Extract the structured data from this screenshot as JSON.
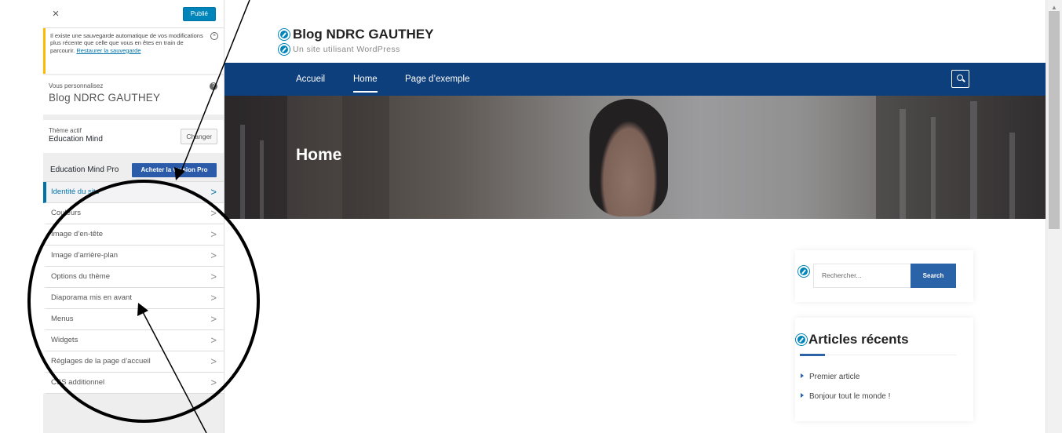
{
  "sidebar": {
    "close_glyph": "×",
    "publish_label": "Publié",
    "notice": {
      "text": "Il existe une sauvegarde automatique de vos modifications plus récente que celle que vous en êtes en train de parcourir. ",
      "link": "Restaurer la sauvegarde"
    },
    "customizing_label": "Vous personnalisez",
    "customizing_title": "Blog NDRC GAUTHEY",
    "help_glyph": "?",
    "theme_label": "Thème actif",
    "theme_name": "Education Mind",
    "change_label": "Changer",
    "pro_label": "Education Mind Pro",
    "pro_button": "Acheter la version Pro",
    "menu": [
      {
        "label": "Identité du site",
        "active": true
      },
      {
        "label": "Couleurs"
      },
      {
        "label": "Image d’en-tête"
      },
      {
        "label": "Image d’arrière-plan"
      },
      {
        "label": "Options du thème"
      },
      {
        "label": "Diaporama mis en avant"
      },
      {
        "label": "Menus"
      },
      {
        "label": "Widgets"
      },
      {
        "label": "Réglages de la page d’accueil"
      },
      {
        "label": "CSS additionnel"
      }
    ],
    "chevron_glyph": ">"
  },
  "site": {
    "title": "Blog NDRC GAUTHEY",
    "tagline": "Un site utilisant WordPress",
    "nav": [
      "Accueil",
      "Home",
      "Page d’exemple"
    ],
    "nav_current": "Home",
    "hero_title": "Home"
  },
  "widgets": {
    "search_placeholder": "Rechercher...",
    "search_button": "Search",
    "recent_title": "Articles récents",
    "recent_items": [
      "Premier article",
      "Bonjour tout le monde !"
    ]
  },
  "colors": {
    "nav_bg": "#0e3f7d",
    "accent": "#0085ba",
    "button_blue": "#2b63a8",
    "annotation": "#000000"
  },
  "icons": [
    "close-icon",
    "dismiss-icon",
    "help-icon",
    "chevron-right-icon",
    "pencil-edit-icon",
    "search-icon"
  ]
}
